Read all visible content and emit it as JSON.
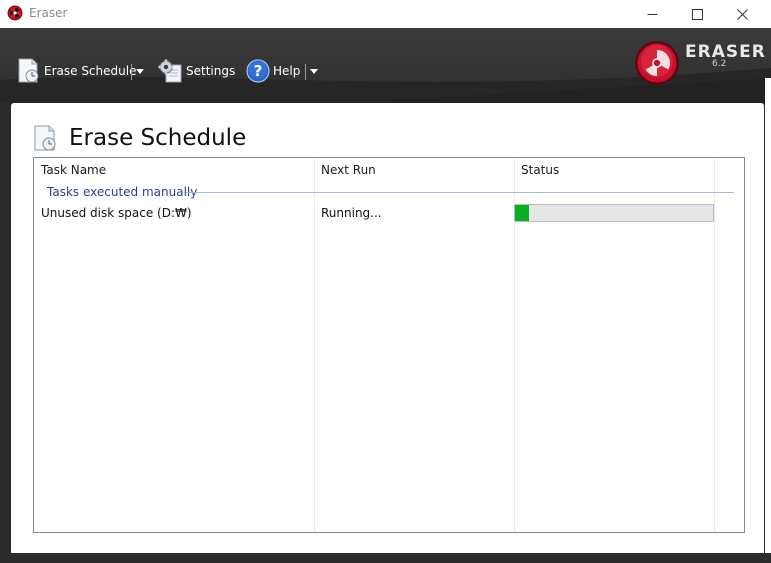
{
  "window": {
    "title": "Eraser",
    "controls": {
      "minimize": "minimize-icon",
      "maximize": "maximize-icon",
      "close": "close-icon"
    }
  },
  "toolbar": {
    "erase_schedule_label": "Erase Schedule",
    "settings_label": "Settings",
    "help_label": "Help"
  },
  "logo": {
    "name": "ERASER",
    "version": "6.2"
  },
  "page": {
    "title": "Erase Schedule"
  },
  "task_list": {
    "columns": [
      "Task Name",
      "Next Run",
      "Status"
    ],
    "group": "Tasks executed manually",
    "rows": [
      {
        "task_name": "Unused disk space (D:₩)",
        "next_run": "Running...",
        "status_progress": 0.07
      }
    ]
  },
  "colors": {
    "toolbar_bg": "#2e2e2e",
    "group_text": "#2b3f8f",
    "progress_fill": "#06b025",
    "logo_red": "#c8102e"
  }
}
